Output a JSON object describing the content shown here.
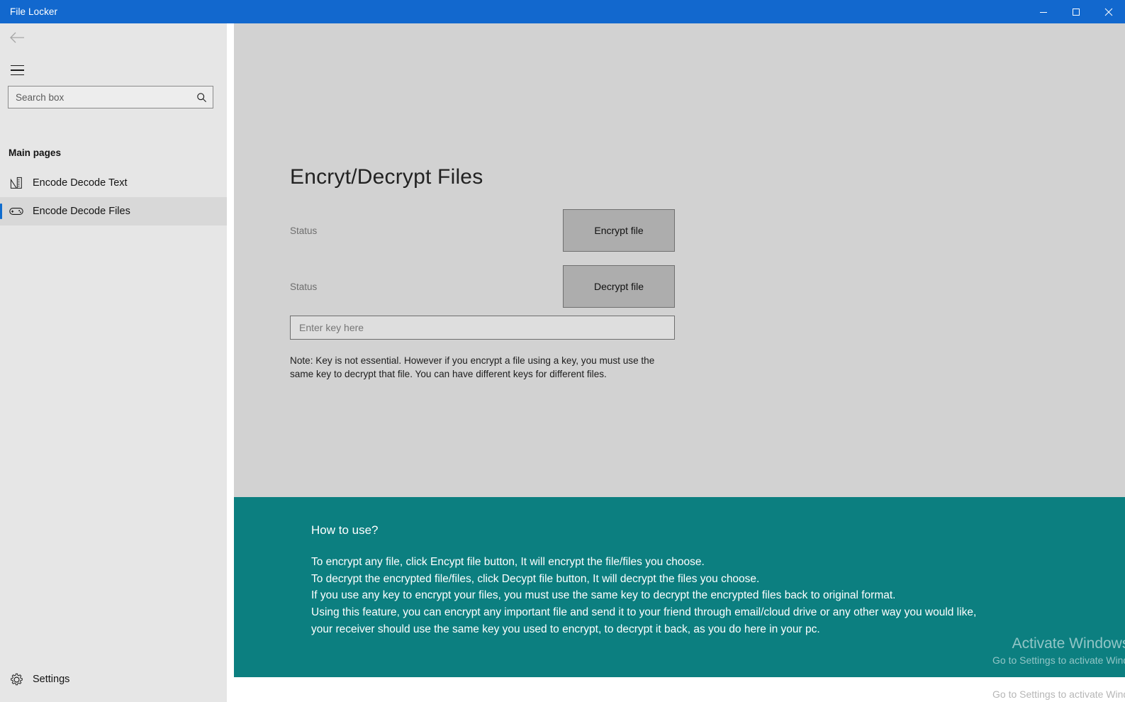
{
  "window": {
    "title": "File Locker",
    "controls": {
      "minimize": "minimize",
      "maximize": "maximize",
      "close": "close"
    }
  },
  "sidebar": {
    "back_icon": "back-arrow-icon",
    "menu_icon": "hamburger-icon",
    "search": {
      "placeholder": "Search box",
      "value": "",
      "icon": "search-icon"
    },
    "section_header": "Main pages",
    "items": [
      {
        "label": "Encode Decode Text",
        "icon": "ruler-pencil-icon",
        "selected": false
      },
      {
        "label": "Encode Decode Files",
        "icon": "gamepad-icon",
        "selected": true
      }
    ],
    "settings": {
      "label": "Settings",
      "icon": "gear-icon"
    }
  },
  "main": {
    "page_title": "Encryt/Decrypt Files",
    "rows": [
      {
        "status": "Status",
        "button": "Encrypt file"
      },
      {
        "status": "Status",
        "button": "Decrypt file"
      }
    ],
    "key_input": {
      "placeholder": "Enter key here",
      "value": ""
    },
    "note": "Note: Key is not essential. However if you encrypt a file using a key, you must use the same key to decrypt that file. You can have different keys for different files."
  },
  "help": {
    "title": "How to use?",
    "lines": [
      "To encrypt any file, click Encypt file button, It will encrypt the file/files you choose.",
      "To decrypt the encrypted file/files, click Decypt file button, It will decrypt the files you choose.",
      "If you use any key to encrypt your files, you must use the same key to decrypt the encrypted files back to original format.",
      "Using this feature, you can encrypt any important file and send it to your friend through email/cloud drive or any other way you would like,",
      "your receiver should use the same key you used to encrypt, to decrypt it back, as you do here in your pc."
    ]
  },
  "watermark": {
    "line1": "Activate Windows",
    "line2": "Go to Settings to activate Windows."
  },
  "colors": {
    "titlebar": "#1268ce",
    "accent": "#0f6cce",
    "teal_panel": "#0c7f80",
    "content_bg": "#d2d2d2",
    "sidebar_bg": "#e6e6e6",
    "button_bg": "#adadad"
  }
}
